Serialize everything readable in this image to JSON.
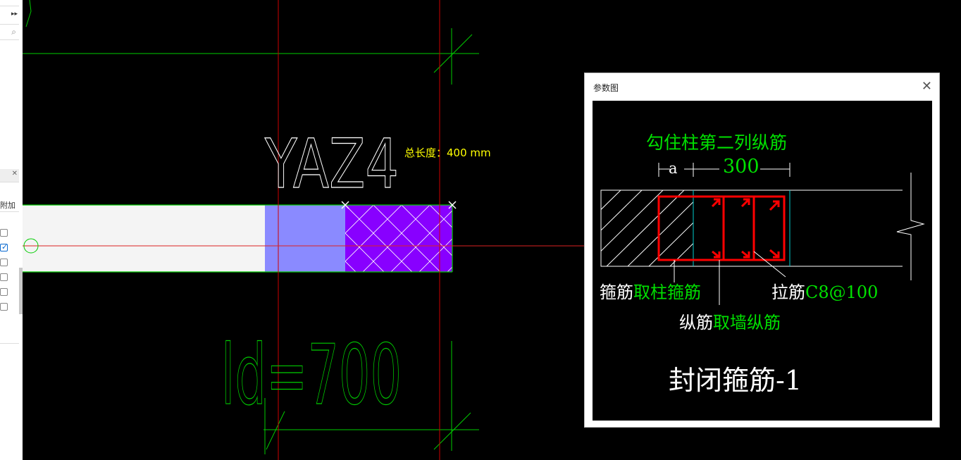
{
  "left_panel": {
    "top_arrow": "▸▸",
    "search_icon": "⌕",
    "close_label": "✕",
    "fujia_label": "附加",
    "checkboxes": [
      false,
      true,
      false,
      false,
      false,
      false
    ]
  },
  "canvas": {
    "element_name": "YAZ4",
    "total_length_label": "总长度：400 mm",
    "ld_label": "ld=700"
  },
  "dialog": {
    "title": "参数图",
    "close_icon": "✕",
    "diagram": {
      "top_note": "勾住柱第二列纵筋",
      "dim_a": "a",
      "dim_300": "300",
      "stirrup_label": "箍筋",
      "stirrup_value": "取柱箍筋",
      "tie_label": "拉筋",
      "tie_value": "C8@100",
      "long_label": "纵筋",
      "long_value": "取墙纵筋",
      "caption": "封闭箍筋-1"
    }
  },
  "colors": {
    "background": "#000000",
    "grid_green": "#00cc00",
    "axis_red": "#cc0000",
    "wall_fill": "#f4f4f4",
    "blue_block": "#8a8aff",
    "purple_block": "#8800ff",
    "label_yellow": "#ffff00",
    "rebar_red": "#ff0000",
    "dim_green": "#00e000"
  }
}
